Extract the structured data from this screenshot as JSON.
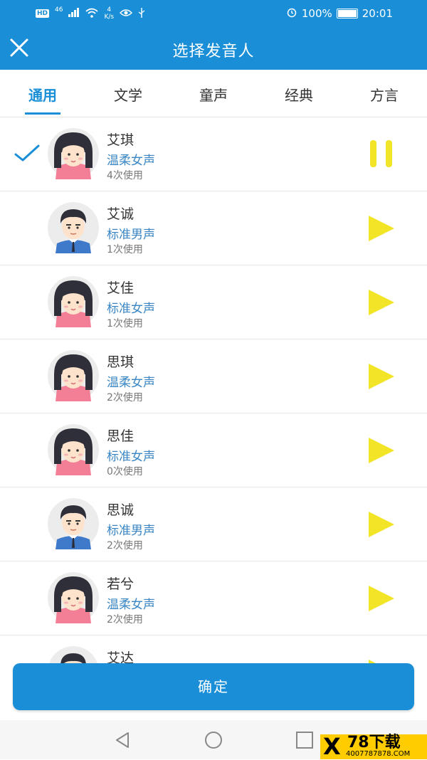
{
  "status_bar": {
    "hd": "HD",
    "network": "46",
    "speed_value": "4",
    "speed_unit": "K/s",
    "battery": "100%",
    "time": "20:01"
  },
  "header": {
    "title": "选择发音人"
  },
  "tabs": [
    {
      "label": "通用",
      "active": true
    },
    {
      "label": "文学",
      "active": false
    },
    {
      "label": "童声",
      "active": false
    },
    {
      "label": "经典",
      "active": false
    },
    {
      "label": "方言",
      "active": false
    }
  ],
  "speakers": [
    {
      "name": "艾琪",
      "type": "温柔女声",
      "usage": "4次使用",
      "gender": "female",
      "selected": true,
      "playing": true
    },
    {
      "name": "艾诚",
      "type": "标准男声",
      "usage": "1次使用",
      "gender": "male",
      "selected": false,
      "playing": false
    },
    {
      "name": "艾佳",
      "type": "标准女声",
      "usage": "1次使用",
      "gender": "female",
      "selected": false,
      "playing": false
    },
    {
      "name": "思琪",
      "type": "温柔女声",
      "usage": "2次使用",
      "gender": "female",
      "selected": false,
      "playing": false
    },
    {
      "name": "思佳",
      "type": "标准女声",
      "usage": "0次使用",
      "gender": "female",
      "selected": false,
      "playing": false
    },
    {
      "name": "思诚",
      "type": "标准男声",
      "usage": "2次使用",
      "gender": "male",
      "selected": false,
      "playing": false
    },
    {
      "name": "若兮",
      "type": "温柔女声",
      "usage": "2次使用",
      "gender": "female",
      "selected": false,
      "playing": false
    },
    {
      "name": "艾达",
      "type": "",
      "usage": "",
      "gender": "male",
      "selected": false,
      "playing": false
    }
  ],
  "confirm_label": "确定",
  "watermark": {
    "main": "78下载",
    "url": "4007787878.COM"
  },
  "colors": {
    "primary": "#1a8fd8",
    "play": "#f2e427",
    "type_text": "#3a86c5"
  }
}
